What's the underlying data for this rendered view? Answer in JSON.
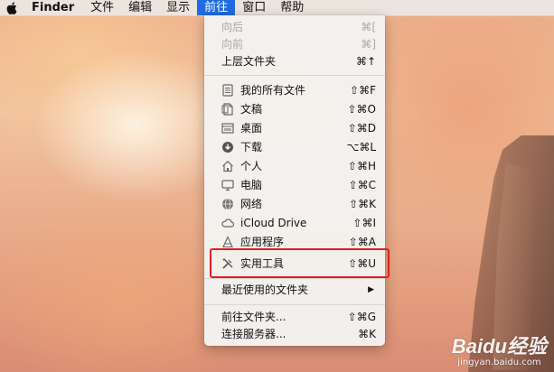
{
  "menubar": {
    "app_name": "Finder",
    "items": [
      "文件",
      "编辑",
      "显示",
      "前往",
      "窗口",
      "帮助"
    ]
  },
  "go_menu": {
    "back": {
      "label": "向后",
      "shortcut": "⌘["
    },
    "forward": {
      "label": "向前",
      "shortcut": "⌘]"
    },
    "enclosing": {
      "label": "上层文件夹",
      "shortcut": "⌘↑"
    },
    "all_files": {
      "label": "我的所有文件",
      "shortcut": "⇧⌘F",
      "icon": "all-files-icon"
    },
    "documents": {
      "label": "文稿",
      "shortcut": "⇧⌘O",
      "icon": "documents-icon"
    },
    "desktop": {
      "label": "桌面",
      "shortcut": "⇧⌘D",
      "icon": "desktop-icon"
    },
    "downloads": {
      "label": "下载",
      "shortcut": "⌥⌘L",
      "icon": "downloads-icon"
    },
    "home": {
      "label": "个人",
      "shortcut": "⇧⌘H",
      "icon": "home-icon"
    },
    "computer": {
      "label": "电脑",
      "shortcut": "⇧⌘C",
      "icon": "computer-icon"
    },
    "network": {
      "label": "网络",
      "shortcut": "⇧⌘K",
      "icon": "network-icon"
    },
    "icloud": {
      "label": "iCloud Drive",
      "shortcut": "⇧⌘I",
      "icon": "cloud-icon"
    },
    "applications": {
      "label": "应用程序",
      "shortcut": "⇧⌘A",
      "icon": "applications-icon"
    },
    "utilities": {
      "label": "实用工具",
      "shortcut": "⇧⌘U",
      "icon": "utilities-icon"
    },
    "recent_folders": {
      "label": "最近使用的文件夹"
    },
    "go_to_folder": {
      "label": "前往文件夹...",
      "shortcut": "⇧⌘G"
    },
    "connect_server": {
      "label": "连接服务器...",
      "shortcut": "⌘K"
    }
  },
  "watermark": {
    "logo": "Baidu经验",
    "url": "jingyan.baidu.com"
  },
  "colors": {
    "menu_highlight": "#1f6ce0",
    "annotation_box": "#e02020"
  }
}
